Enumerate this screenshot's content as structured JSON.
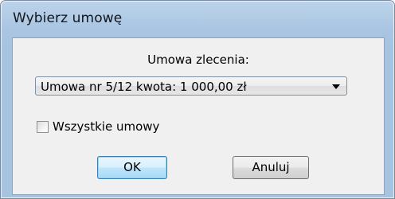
{
  "window": {
    "title": "Wybierz umowę"
  },
  "form": {
    "contract_label": "Umowa zlecenia:",
    "contract_selected": "Umowa nr 5/12 kwota: 1 000,00 zł",
    "all_contracts_label": "Wszystkie umowy",
    "all_contracts_checked": false
  },
  "buttons": {
    "ok_label": "OK",
    "cancel_label": "Anuluj"
  },
  "icons": {
    "dropdown": "chevron-down-icon"
  },
  "colors": {
    "titlebar": "#b3cde6",
    "dialog_background": "#f0f0f0",
    "default_button_border": "#3c7fb1"
  }
}
